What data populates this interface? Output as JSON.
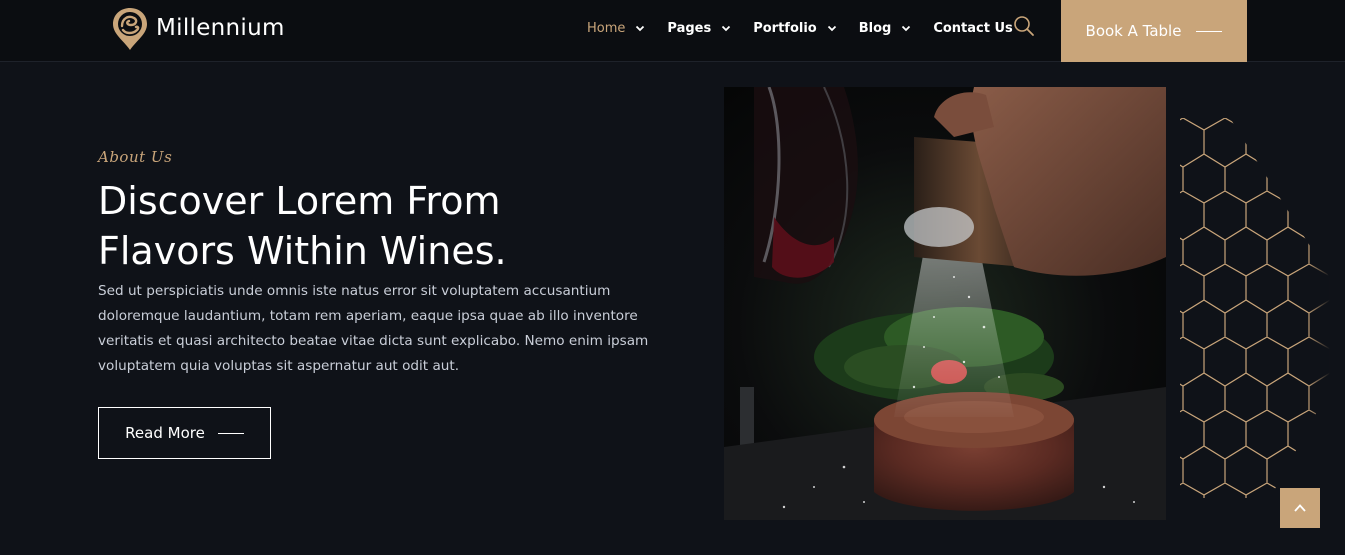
{
  "brand": {
    "name": "Millennium",
    "accent": "#c9a57a",
    "background": "#0f1218",
    "header_background": "#0b0d11"
  },
  "nav": {
    "items": [
      {
        "label": "Home",
        "active": true,
        "dropdown": true
      },
      {
        "label": "Pages",
        "active": false,
        "dropdown": true
      },
      {
        "label": "Portfolio",
        "active": false,
        "dropdown": true
      },
      {
        "label": "Blog",
        "active": false,
        "dropdown": true
      },
      {
        "label": "Contact Us",
        "active": false,
        "dropdown": false
      }
    ],
    "search_icon": "search-icon",
    "cta_label": "Book A Table"
  },
  "hero": {
    "eyebrow": "About Us",
    "heading_line1": "Discover Lorem From",
    "heading_line2": "Flavors Within Wines.",
    "paragraph": "Sed ut perspiciatis unde omnis iste natus error sit voluptatem accusantium doloremque laudantium, totam rem aperiam, eaque ipsa quae ab illo inventore veritatis et quasi architecto beatae vitae dicta sunt explicabo. Nemo enim ipsam voluptatem quia voluptas sit aspernatur aut odit aut.",
    "button_label": "Read More"
  },
  "media": {
    "photo_icon": "steak-photo",
    "pattern_icon": "hexagon-pattern"
  },
  "scroll_top_icon": "chevron-up-icon"
}
